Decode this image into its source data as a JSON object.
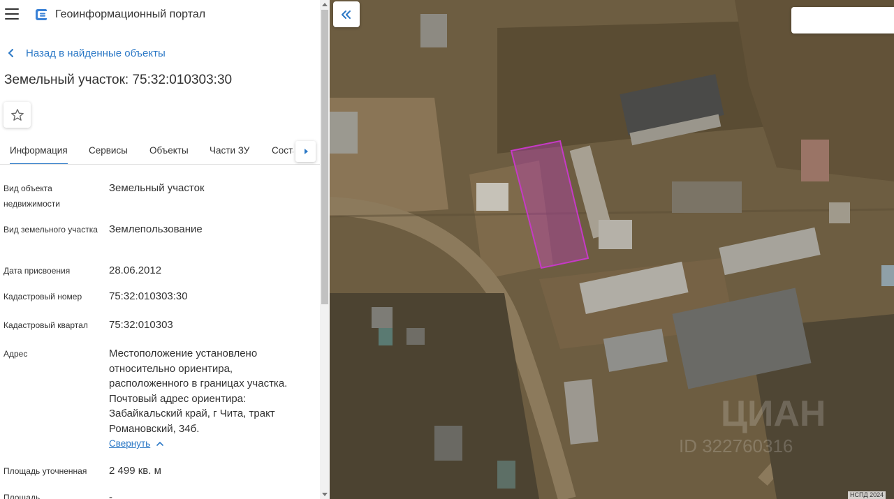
{
  "app": {
    "title": "Геоинформационный портал",
    "menu_icon": "hamburger-icon",
    "logo_icon": "portal-logo-icon"
  },
  "nav": {
    "back_label": "Назад в найденные объекты"
  },
  "object": {
    "title": "Земельный участок: 75:32:010303:30",
    "favorite_icon": "star-icon"
  },
  "tabs": [
    {
      "label": "Информация",
      "active": true
    },
    {
      "label": "Сервисы"
    },
    {
      "label": "Объекты"
    },
    {
      "label": "Части ЗУ"
    },
    {
      "label": "Соста..."
    }
  ],
  "properties": [
    {
      "label": "Вид объекта недвижимости",
      "value": "Земельный участок"
    },
    {
      "label": "Вид земельного участка",
      "value": "Землепользование"
    },
    {
      "label": "Дата присвоения",
      "value": "28.06.2012"
    },
    {
      "label": "Кадастровый номер",
      "value": "75:32:010303:30"
    },
    {
      "label": "Кадастровый квартал",
      "value": "75:32:010303"
    },
    {
      "label": "Адрес",
      "value": "Местоположение установлено относительно ориентира, расположенного в границах участка. Почтовый адрес ориентира: Забайкальский край, г Чита, тракт Романовский, 34б."
    },
    {
      "label": "Площадь уточненная",
      "value": "2 499 кв. м"
    },
    {
      "label": "Площадь",
      "value": "-"
    }
  ],
  "address_toggle": {
    "label": "Свернуть"
  },
  "map": {
    "search_placeholder": "",
    "attribution": "НСПД 2024",
    "watermark": "ЦИАН ID 322760316",
    "parcel_color": "#c63ac6"
  },
  "colors": {
    "accent": "#2b78c6",
    "text": "#333333"
  }
}
